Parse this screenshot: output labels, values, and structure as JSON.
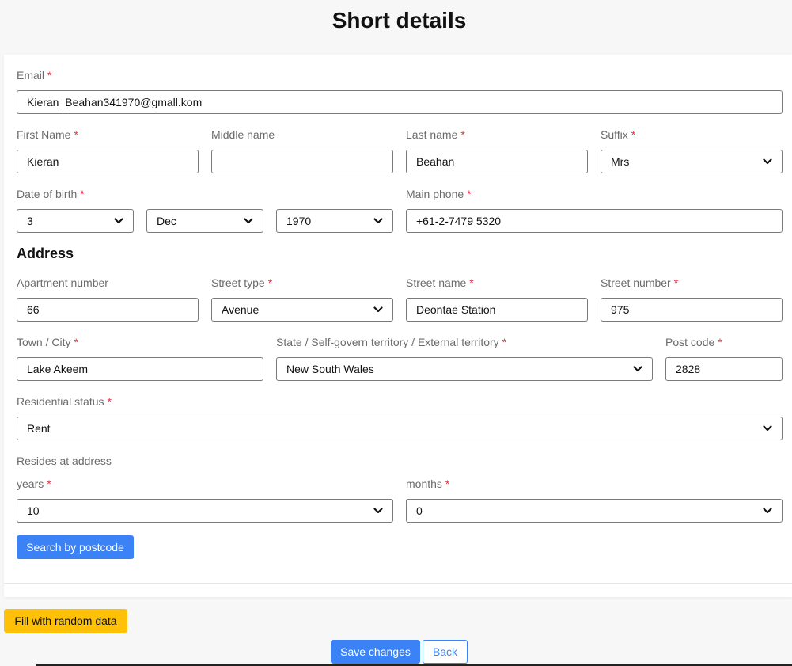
{
  "page": {
    "title": "Short details"
  },
  "form": {
    "required_mark": "*",
    "email": {
      "label": "Email",
      "value": "Kieran_Beahan341970@gmall.kom"
    },
    "first_name": {
      "label": "First Name",
      "value": "Kieran"
    },
    "middle_name": {
      "label": "Middle name",
      "value": ""
    },
    "last_name": {
      "label": "Last name",
      "value": "Beahan"
    },
    "suffix": {
      "label": "Suffix",
      "value": "Mrs"
    },
    "dob": {
      "label": "Date of birth",
      "day": "3",
      "month": "Dec",
      "year": "1970"
    },
    "main_phone": {
      "label": "Main phone",
      "value": "+61-2-7479 5320"
    },
    "address": {
      "heading": "Address",
      "apartment_number": {
        "label": "Apartment number",
        "value": "66"
      },
      "street_type": {
        "label": "Street type",
        "value": "Avenue"
      },
      "street_name": {
        "label": "Street name",
        "value": "Deontae Station"
      },
      "street_number": {
        "label": "Street number",
        "value": "975"
      },
      "town": {
        "label": "Town / City",
        "value": "Lake Akeem"
      },
      "state": {
        "label": "State / Self-govern territory / External territory",
        "value": "New South Wales"
      },
      "post_code": {
        "label": "Post code",
        "value": "2828"
      },
      "residential_status": {
        "label": "Residential status",
        "value": "Rent"
      },
      "resides": {
        "label": "Resides at address",
        "years": {
          "label": "years",
          "value": "10"
        },
        "months": {
          "label": "months",
          "value": "0"
        }
      }
    },
    "search_button": "Search by postcode"
  },
  "actions": {
    "fill_random": "Fill with random data",
    "save": "Save changes",
    "back": "Back"
  },
  "colors": {
    "primary": "#3b82f6",
    "warning": "#ffc107",
    "required": "#dc3545"
  },
  "icons": {
    "select_chevron": "chevron-down-icon"
  }
}
